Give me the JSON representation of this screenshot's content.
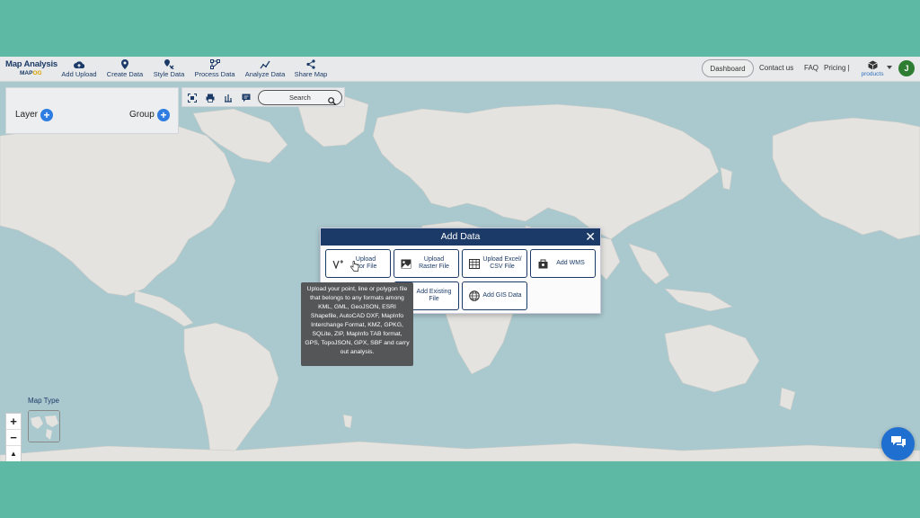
{
  "brand": {
    "title": "Map Analysis",
    "logo_prefix": "MAP",
    "logo_suffix": "OG"
  },
  "nav": [
    {
      "label": "Add Upload",
      "icon": "cloud-upload-icon"
    },
    {
      "label": "Create Data",
      "icon": "map-pin-icon"
    },
    {
      "label": "Style Data",
      "icon": "style-pin-icon"
    },
    {
      "label": "Process Data",
      "icon": "process-icon"
    },
    {
      "label": "Analyze Data",
      "icon": "analyze-icon"
    },
    {
      "label": "Share Map",
      "icon": "share-icon"
    }
  ],
  "header_right": {
    "dashboard": "Dashboard",
    "contact": "Contact us",
    "faq": "FAQ",
    "pricing": "Pricing |",
    "products": "products",
    "avatar_initial": "J"
  },
  "layer_panel": {
    "layer_label": "Layer",
    "group_label": "Group"
  },
  "toolbar": {
    "search_label": "Search"
  },
  "dialog": {
    "title": "Add Data",
    "options": [
      {
        "label": "Upload\nctor File",
        "icon": "vector-icon"
      },
      {
        "label": "Upload\nRaster File",
        "icon": "raster-icon"
      },
      {
        "label": "Upload Excel/\nCSV File",
        "icon": "table-icon"
      },
      {
        "label": "Add WMS",
        "icon": "wms-icon"
      },
      {
        "label": "Add Existing\nFile",
        "icon": "file-icon"
      },
      {
        "label": "Add GIS Data",
        "icon": "globe-icon"
      }
    ]
  },
  "tooltip": {
    "text": "Upload your point, line or polygon file that belongs to any formats among KML, GML, GeoJSON, ESRI Shapefile, AutoCAD DXF, MapInfo Interchange Format, KMZ, GPKG, SQLite, ZIP, MapInfo TAB format, GPS, TopoJSON, GPX, SBF and carry out analysis."
  },
  "map_type": {
    "label": "Map Type"
  },
  "zoom": {
    "in": "+",
    "out": "−",
    "reset": "▲"
  },
  "colors": {
    "brand_navy": "#1b3a67",
    "frame_teal": "#5db8a4",
    "accent_blue": "#2f7de0",
    "ocean": "#aac9cf",
    "land": "#e4e3df"
  }
}
